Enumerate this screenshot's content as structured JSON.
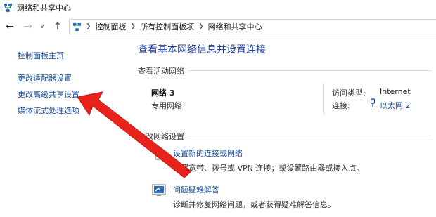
{
  "window": {
    "title": "网络和共享中心"
  },
  "address_bar": {
    "crumbs": [
      "控制面板",
      "所有控制面板项",
      "网络和共享中心"
    ]
  },
  "sidebar": {
    "home_label": "控制面板主页",
    "items": [
      {
        "label": "更改适配器设置"
      },
      {
        "label": "更改高级共享设置"
      },
      {
        "label": "媒体流式处理选项"
      }
    ]
  },
  "main": {
    "title": "查看基本网络信息并设置连接",
    "active_networks_label": "查看活动网络",
    "network": {
      "name": "网络 3",
      "type": "专用网络",
      "access_type_label": "访问类型:",
      "access_type_value": "Internet",
      "connections_label": "连接:",
      "connections_value": "以太网 2"
    },
    "change_settings_label": "更改网络设置",
    "tasks": [
      {
        "link": "设置新的连接或网络",
        "desc": "设置宽带、拨号或 VPN 连接；或设置路由器或接入点。"
      },
      {
        "link": "问题疑难解答",
        "desc": "诊断并修复网络问题，或者获得疑难解答信息。"
      }
    ]
  },
  "annotation": {
    "arrow_color": "#e8231c"
  },
  "icons": {
    "app": "network-icon",
    "back": "arrow-left-icon",
    "forward": "arrow-right-icon",
    "recent": "chevron-down-icon",
    "up": "arrow-up-icon",
    "connection": "ethernet-icon",
    "new_connection": "network-setup-icon",
    "troubleshoot": "troubleshoot-icon"
  }
}
